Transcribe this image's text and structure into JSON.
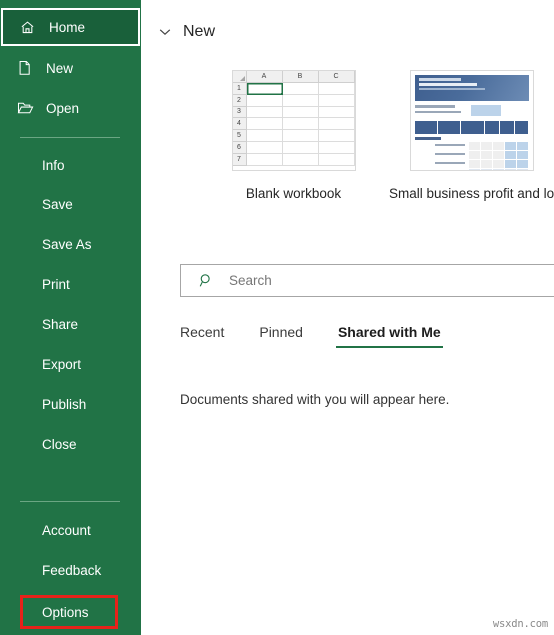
{
  "colors": {
    "sidebar_green": "#217346",
    "sidebar_active_green": "#19603a",
    "accent_underline": "#217346",
    "annotation_red": "#e8221a",
    "divider_green": "#6ba683"
  },
  "sidebar": {
    "top_items": [
      {
        "label": "Home",
        "icon": "home-icon",
        "active": true
      },
      {
        "label": "New",
        "icon": "new-document-icon",
        "active": false
      },
      {
        "label": "Open",
        "icon": "open-folder-icon",
        "active": false
      }
    ],
    "middle_items": [
      {
        "label": "Info"
      },
      {
        "label": "Save"
      },
      {
        "label": "Save As"
      },
      {
        "label": "Print"
      },
      {
        "label": "Share"
      },
      {
        "label": "Export"
      },
      {
        "label": "Publish"
      },
      {
        "label": "Close"
      }
    ],
    "bottom_items": [
      {
        "label": "Account"
      },
      {
        "label": "Feedback"
      },
      {
        "label": "Options",
        "highlighted": true
      }
    ]
  },
  "main": {
    "new_section": {
      "title": "New",
      "chevron": "chevron-down-icon",
      "templates": [
        {
          "caption": "Blank workbook",
          "thumb_type": "spreadsheet-grid",
          "columns": [
            "A",
            "B",
            "C"
          ],
          "rows": [
            "1",
            "2",
            "3",
            "4",
            "5",
            "6",
            "7"
          ],
          "selected_cell": "A1"
        },
        {
          "caption": "Small business profit and los...",
          "thumb_type": "profit-loss-statement"
        }
      ]
    },
    "search": {
      "icon": "search-icon",
      "placeholder": "Search",
      "value": ""
    },
    "tabs": [
      {
        "label": "Recent",
        "active": false
      },
      {
        "label": "Pinned",
        "active": false
      },
      {
        "label": "Shared with Me",
        "active": true
      }
    ],
    "empty_message": "Documents shared with you will appear here."
  },
  "watermark": "wsxdn.com"
}
